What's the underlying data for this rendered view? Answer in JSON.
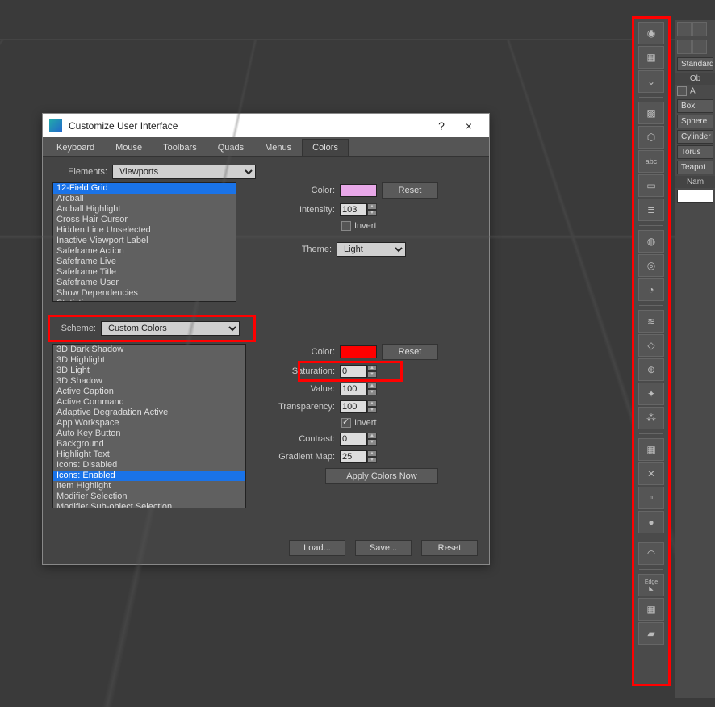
{
  "dialog": {
    "title": "Customize User Interface",
    "help_symbol": "?",
    "close_symbol": "×",
    "tabs": [
      "Keyboard",
      "Mouse",
      "Toolbars",
      "Quads",
      "Menus",
      "Colors"
    ],
    "active_tab": 5,
    "elements_label": "Elements:",
    "elements_value": "Viewports",
    "element_items": [
      "12-Field Grid",
      "Arcball",
      "Arcball Highlight",
      "Cross Hair Cursor",
      "Hidden Line Unselected",
      "Inactive Viewport Label",
      "Safeframe Action",
      "Safeframe Live",
      "Safeframe Title",
      "Safeframe User",
      "Show Dependencies",
      "Statistics"
    ],
    "element_selected_index": 0,
    "top_right": {
      "color_label": "Color:",
      "color_hex": "#e8a8e8",
      "reset_label": "Reset",
      "intensity_label": "Intensity:",
      "intensity_value": "103",
      "invert_label": "Invert",
      "invert_checked": false,
      "theme_label": "Theme:",
      "theme_value": "Light"
    },
    "scheme_label": "Scheme:",
    "scheme_value": "Custom Colors",
    "scheme_items": [
      "3D Dark Shadow",
      "3D Highlight",
      "3D Light",
      "3D Shadow",
      "Active Caption",
      "Active Command",
      "Adaptive Degradation Active",
      "App Workspace",
      "Auto Key Button",
      "Background",
      "Highlight Text",
      "Icons: Disabled",
      "Icons: Enabled",
      "Item Highlight",
      "Modifier Selection",
      "Modifier Sub-object Selection"
    ],
    "scheme_selected_index": 12,
    "bottom_right": {
      "color_label": "Color:",
      "color_hex": "#ff0000",
      "reset_label": "Reset",
      "saturation_label": "Saturation:",
      "saturation_value": "0",
      "value_label": "Value:",
      "value_value": "100",
      "transparency_label": "Transparency:",
      "transparency_value": "100",
      "invert_label": "Invert",
      "invert_checked": true,
      "contrast_label": "Contrast:",
      "contrast_value": "0",
      "gradientmap_label": "Gradient Map:",
      "gradientmap_value": "25",
      "apply_label": "Apply Colors Now"
    },
    "buttons": {
      "load": "Load...",
      "save": "Save...",
      "reset": "Reset"
    }
  },
  "right_panel": {
    "dropdown": "Standard Pr",
    "header1": "Ob",
    "checkbox_label": "A",
    "buttons": [
      "Box",
      "Sphere",
      "Cylinder",
      "Torus",
      "Teapot"
    ],
    "name_label": "Nam"
  },
  "toolbar_icons": [
    "aperture-icon",
    "region-select-icon",
    "chevrons-down-icon",
    "sep",
    "texture-icon",
    "wireframe-icon",
    "abc-text-icon",
    "caption-icon",
    "list-settings-icon",
    "sep",
    "light-rig-icon",
    "light-pair-icon",
    "protractor-icon",
    "sep",
    "deform-icon",
    "snap-vertex-icon",
    "boolean-icon",
    "scatter-icon",
    "particles-icon",
    "sep",
    "array-icon",
    "xform-icon",
    "numeric-icon",
    "sphere-icon",
    "sep",
    "arc-icon",
    "sep",
    "edge-icon",
    "grid-icon",
    "ground-icon"
  ],
  "edge_label": "Edge"
}
